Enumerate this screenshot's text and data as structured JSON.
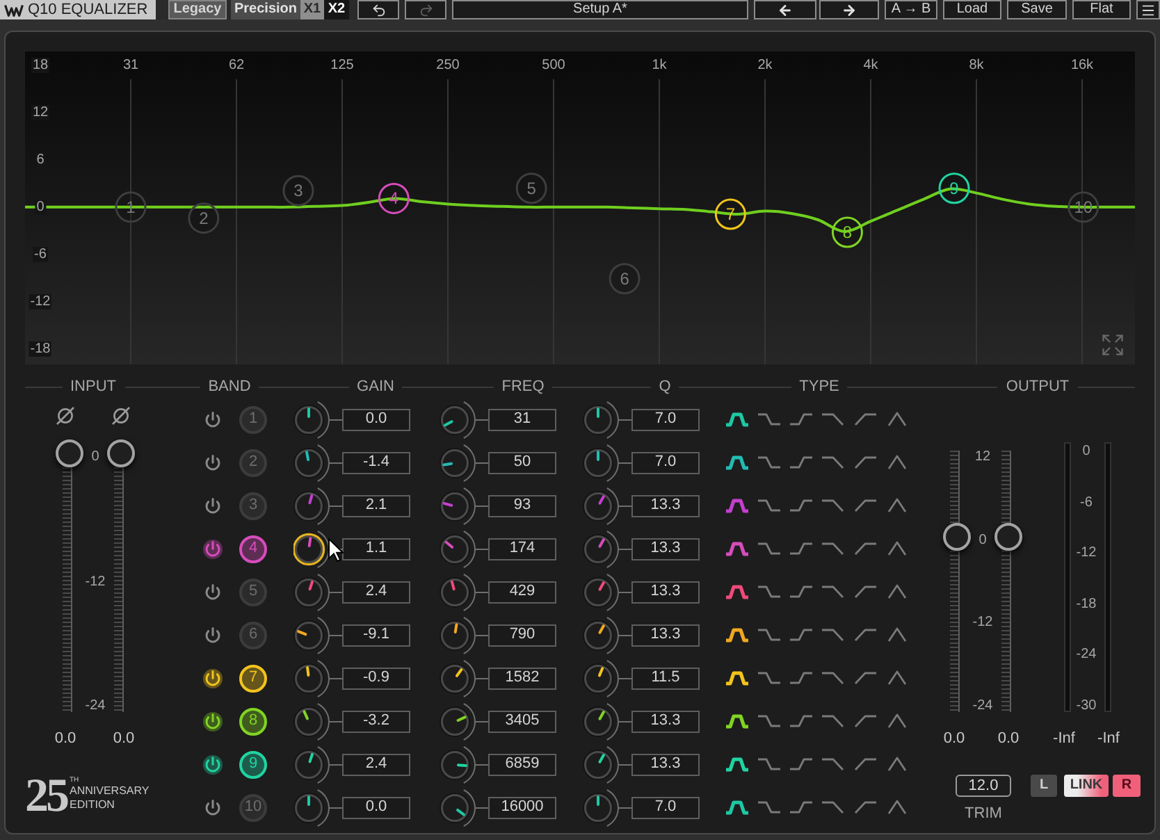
{
  "toolbar": {
    "title": "Q10 EQUALIZER",
    "legacy": "Legacy",
    "precision": "Precision",
    "precision_options": [
      {
        "label": "X1",
        "selected": false
      },
      {
        "label": "X2",
        "selected": true
      }
    ],
    "undo": {
      "disabled": false
    },
    "redo": {
      "disabled": true
    },
    "preset": "Setup A*",
    "ab": "A → B",
    "buttons": [
      "Load",
      "Save",
      "Flat"
    ]
  },
  "graph": {
    "chart_data": {
      "type": "line",
      "grid": true,
      "categories": [
        null,
        null,
        null,
        null,
        "31",
        null,
        null,
        null,
        "62",
        null,
        null,
        null,
        "125",
        null,
        null,
        null,
        "250",
        null,
        null,
        null,
        "500",
        null,
        null,
        null,
        "1k",
        null,
        null,
        null,
        "2k",
        null,
        null,
        null,
        "4k",
        null,
        null,
        null,
        "8k",
        null,
        null,
        null,
        "16k",
        null,
        null
      ],
      "series": [
        {
          "color": "#6fcf1f",
          "values": [
            0,
            0,
            0,
            0,
            0,
            0,
            0,
            0,
            0,
            0,
            0,
            0.1,
            0.2,
            0.6,
            1.1,
            0.7,
            0.4,
            0.2,
            0.1,
            0,
            0,
            0,
            0,
            -0.1,
            -0.2,
            -0.3,
            -0.6,
            -0.9,
            -0.5,
            -0.8,
            -1.6,
            -3.1,
            -1.8,
            -0.4,
            1.0,
            2.3,
            1.8,
            1.0,
            0.4,
            0.1,
            0,
            0,
            0
          ]
        }
      ],
      "ylim": [
        -20,
        19.8
      ],
      "yticks": [
        {
          "value": 18,
          "label": "18"
        },
        {
          "value": 12,
          "label": "12"
        },
        {
          "value": 6,
          "label": "6"
        },
        {
          "value": 0,
          "label": "0"
        },
        {
          "value": -6,
          "label": "-6"
        },
        {
          "value": -12,
          "label": "-12"
        },
        {
          "value": -18,
          "label": "-18"
        }
      ]
    },
    "node_labels": [
      "1",
      "2",
      "3",
      "4",
      "5",
      "6",
      "7",
      "8",
      "9",
      "10"
    ]
  },
  "headers": [
    "INPUT",
    "BAND",
    "GAIN",
    "FREQ",
    "Q",
    "TYPE",
    "OUTPUT"
  ],
  "input": {
    "scale": [
      "0",
      "-12",
      "-24"
    ],
    "faders": [
      {
        "level": 1,
        "value": "0.0"
      },
      {
        "level": 1,
        "value": "0.0"
      }
    ]
  },
  "bands": [
    {
      "number": "1",
      "on": false,
      "color": "#1ec8a5",
      "gain": "0.0",
      "gain_hovered": false,
      "freq": "31",
      "q": "7.0",
      "types": [
        {
          "kind": "bell",
          "selected": true
        },
        {
          "kind": "low-shelf",
          "selected": false
        },
        {
          "kind": "high-shelf",
          "selected": false
        },
        {
          "kind": "low-pass",
          "selected": false
        },
        {
          "kind": "high-pass",
          "selected": false
        },
        {
          "kind": "notch",
          "selected": false
        }
      ]
    },
    {
      "number": "2",
      "on": false,
      "color": "#22bcb4",
      "gain": "-1.4",
      "gain_hovered": false,
      "freq": "50",
      "q": "7.0",
      "types": [
        {
          "kind": "bell",
          "selected": true
        },
        {
          "kind": "low-shelf",
          "selected": false
        },
        {
          "kind": "high-shelf",
          "selected": false
        },
        {
          "kind": "low-pass",
          "selected": false
        },
        {
          "kind": "high-pass",
          "selected": false
        },
        {
          "kind": "notch",
          "selected": false
        }
      ]
    },
    {
      "number": "3",
      "on": false,
      "color": "#c43fcf",
      "gain": "2.1",
      "gain_hovered": false,
      "freq": "93",
      "q": "13.3",
      "types": [
        {
          "kind": "bell",
          "selected": true
        },
        {
          "kind": "low-shelf",
          "selected": false
        },
        {
          "kind": "high-shelf",
          "selected": false
        },
        {
          "kind": "low-pass",
          "selected": false
        },
        {
          "kind": "high-pass",
          "selected": false
        },
        {
          "kind": "notch",
          "selected": false
        }
      ]
    },
    {
      "number": "4",
      "on": true,
      "color": "#d64cbc",
      "gain": "1.1",
      "gain_hovered": true,
      "freq": "174",
      "q": "13.3",
      "types": [
        {
          "kind": "bell",
          "selected": true
        },
        {
          "kind": "low-shelf",
          "selected": false
        },
        {
          "kind": "high-shelf",
          "selected": false
        },
        {
          "kind": "low-pass",
          "selected": false
        },
        {
          "kind": "high-pass",
          "selected": false
        },
        {
          "kind": "notch",
          "selected": false
        }
      ]
    },
    {
      "number": "5",
      "on": false,
      "color": "#f04a7c",
      "gain": "2.4",
      "gain_hovered": false,
      "freq": "429",
      "q": "13.3",
      "types": [
        {
          "kind": "bell",
          "selected": true
        },
        {
          "kind": "low-shelf",
          "selected": false
        },
        {
          "kind": "high-shelf",
          "selected": false
        },
        {
          "kind": "low-pass",
          "selected": false
        },
        {
          "kind": "high-pass",
          "selected": false
        },
        {
          "kind": "notch",
          "selected": false
        }
      ]
    },
    {
      "number": "6",
      "on": false,
      "color": "#f0a820",
      "gain": "-9.1",
      "gain_hovered": false,
      "freq": "790",
      "q": "13.3",
      "types": [
        {
          "kind": "bell",
          "selected": true
        },
        {
          "kind": "low-shelf",
          "selected": false
        },
        {
          "kind": "high-shelf",
          "selected": false
        },
        {
          "kind": "low-pass",
          "selected": false
        },
        {
          "kind": "high-pass",
          "selected": false
        },
        {
          "kind": "notch",
          "selected": false
        }
      ]
    },
    {
      "number": "7",
      "on": true,
      "color": "#f2c41c",
      "gain": "-0.9",
      "gain_hovered": false,
      "freq": "1582",
      "q": "11.5",
      "types": [
        {
          "kind": "bell",
          "selected": true
        },
        {
          "kind": "low-shelf",
          "selected": false
        },
        {
          "kind": "high-shelf",
          "selected": false
        },
        {
          "kind": "low-pass",
          "selected": false
        },
        {
          "kind": "high-pass",
          "selected": false
        },
        {
          "kind": "notch",
          "selected": false
        }
      ]
    },
    {
      "number": "8",
      "on": true,
      "color": "#80d423",
      "gain": "-3.2",
      "gain_hovered": false,
      "freq": "3405",
      "q": "13.3",
      "types": [
        {
          "kind": "bell",
          "selected": true
        },
        {
          "kind": "low-shelf",
          "selected": false
        },
        {
          "kind": "high-shelf",
          "selected": false
        },
        {
          "kind": "low-pass",
          "selected": false
        },
        {
          "kind": "high-pass",
          "selected": false
        },
        {
          "kind": "notch",
          "selected": false
        }
      ]
    },
    {
      "number": "9",
      "on": true,
      "color": "#20d4a2",
      "gain": "2.4",
      "gain_hovered": false,
      "freq": "6859",
      "q": "13.3",
      "types": [
        {
          "kind": "bell",
          "selected": true
        },
        {
          "kind": "low-shelf",
          "selected": false
        },
        {
          "kind": "high-shelf",
          "selected": false
        },
        {
          "kind": "low-pass",
          "selected": false
        },
        {
          "kind": "high-pass",
          "selected": false
        },
        {
          "kind": "notch",
          "selected": false
        }
      ]
    },
    {
      "number": "10",
      "on": false,
      "color": "#1ec8a5",
      "gain": "0.0",
      "gain_hovered": false,
      "freq": "16000",
      "q": "7.0",
      "types": [
        {
          "kind": "bell",
          "selected": true
        },
        {
          "kind": "low-shelf",
          "selected": false
        },
        {
          "kind": "high-shelf",
          "selected": false
        },
        {
          "kind": "low-pass",
          "selected": false
        },
        {
          "kind": "high-pass",
          "selected": false
        },
        {
          "kind": "notch",
          "selected": false
        }
      ]
    }
  ],
  "output": {
    "fader_scale": [
      "12",
      "0",
      "-12",
      "-24"
    ],
    "faders": [
      {
        "level": 0.667,
        "value": "0.0"
      },
      {
        "level": 0.667,
        "value": "0.0"
      }
    ],
    "meter_scale": [
      "0",
      "-6",
      "-12",
      "-18",
      "-24",
      "-30"
    ],
    "meters": [
      {
        "level": 0,
        "value": "-Inf"
      },
      {
        "level": 0,
        "value": "-Inf"
      }
    ],
    "trim": {
      "value": "12.0",
      "label": "TRIM"
    },
    "channel_buttons": [
      {
        "kind": "channel",
        "label": "L",
        "on": false
      },
      {
        "kind": "link",
        "label": "LINK",
        "on": true
      },
      {
        "kind": "channel",
        "label": "R",
        "on": true
      }
    ]
  },
  "badge": {
    "number": "25",
    "suffix": "TH",
    "lines": [
      "ANNIVERSARY",
      "EDITION"
    ]
  }
}
